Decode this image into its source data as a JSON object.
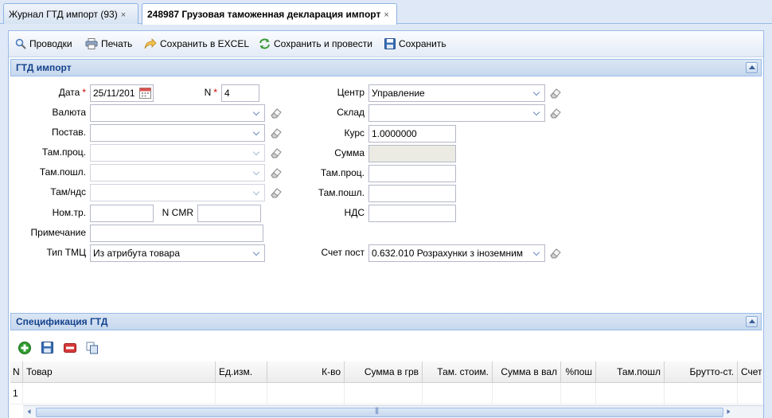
{
  "tabs": [
    {
      "label": "Журнал ГТД импорт (93)",
      "close": "×"
    },
    {
      "label": "248987 Грузовая таможенная декларация импорт",
      "close": "×"
    }
  ],
  "toolbar": {
    "entries": "Проводки",
    "print": "Печать",
    "excel": "Сохранить в EXCEL",
    "save_post": "Сохранить и провести",
    "save": "Сохранить"
  },
  "header_panel": {
    "title": "ГТД импорт",
    "fields": {
      "date_label": "Дата",
      "date_value": "25/11/201",
      "n_label": "N",
      "n_value": "4",
      "currency_label": "Валюта",
      "supplier_label": "Постав.",
      "customs_proc_label": "Там.проц.",
      "customs_duty_label": "Там.пошл.",
      "customs_vat_label": "Там/ндс",
      "invoice_no_label": "Ном.тр.",
      "cmr_label": "N CMR",
      "note_label": "Примечание",
      "goods_type_label": "Тип ТМЦ",
      "goods_type_value": "Из атрибута товара",
      "center_label": "Центр",
      "center_value": "Управление",
      "warehouse_label": "Склад",
      "rate_label": "Курс",
      "rate_value": "1.0000000",
      "sum_label": "Сумма",
      "r_customs_proc_label": "Там.проц.",
      "r_customs_duty_label": "Там.пошл.",
      "vat_label": "НДС",
      "supplier_account_label": "Счет пост",
      "supplier_account_value": "0.632.010 Розрахунки з іноземним"
    },
    "required_mark": "*"
  },
  "spec_panel": {
    "title": "Спецификация ГТД",
    "columns": [
      "N",
      "Товар",
      "Ед.изм.",
      "К-во",
      "Сумма в грв",
      "Там. стоим.",
      "Сумма в вал",
      "%пош",
      "Там.пошл",
      "Брутто-ст.",
      "Счет"
    ],
    "rows": [
      [
        "1",
        "",
        "",
        "",
        "",
        "",
        "",
        "",
        "",
        "",
        ""
      ]
    ]
  },
  "scrollbar": {
    "grip": "|||"
  }
}
